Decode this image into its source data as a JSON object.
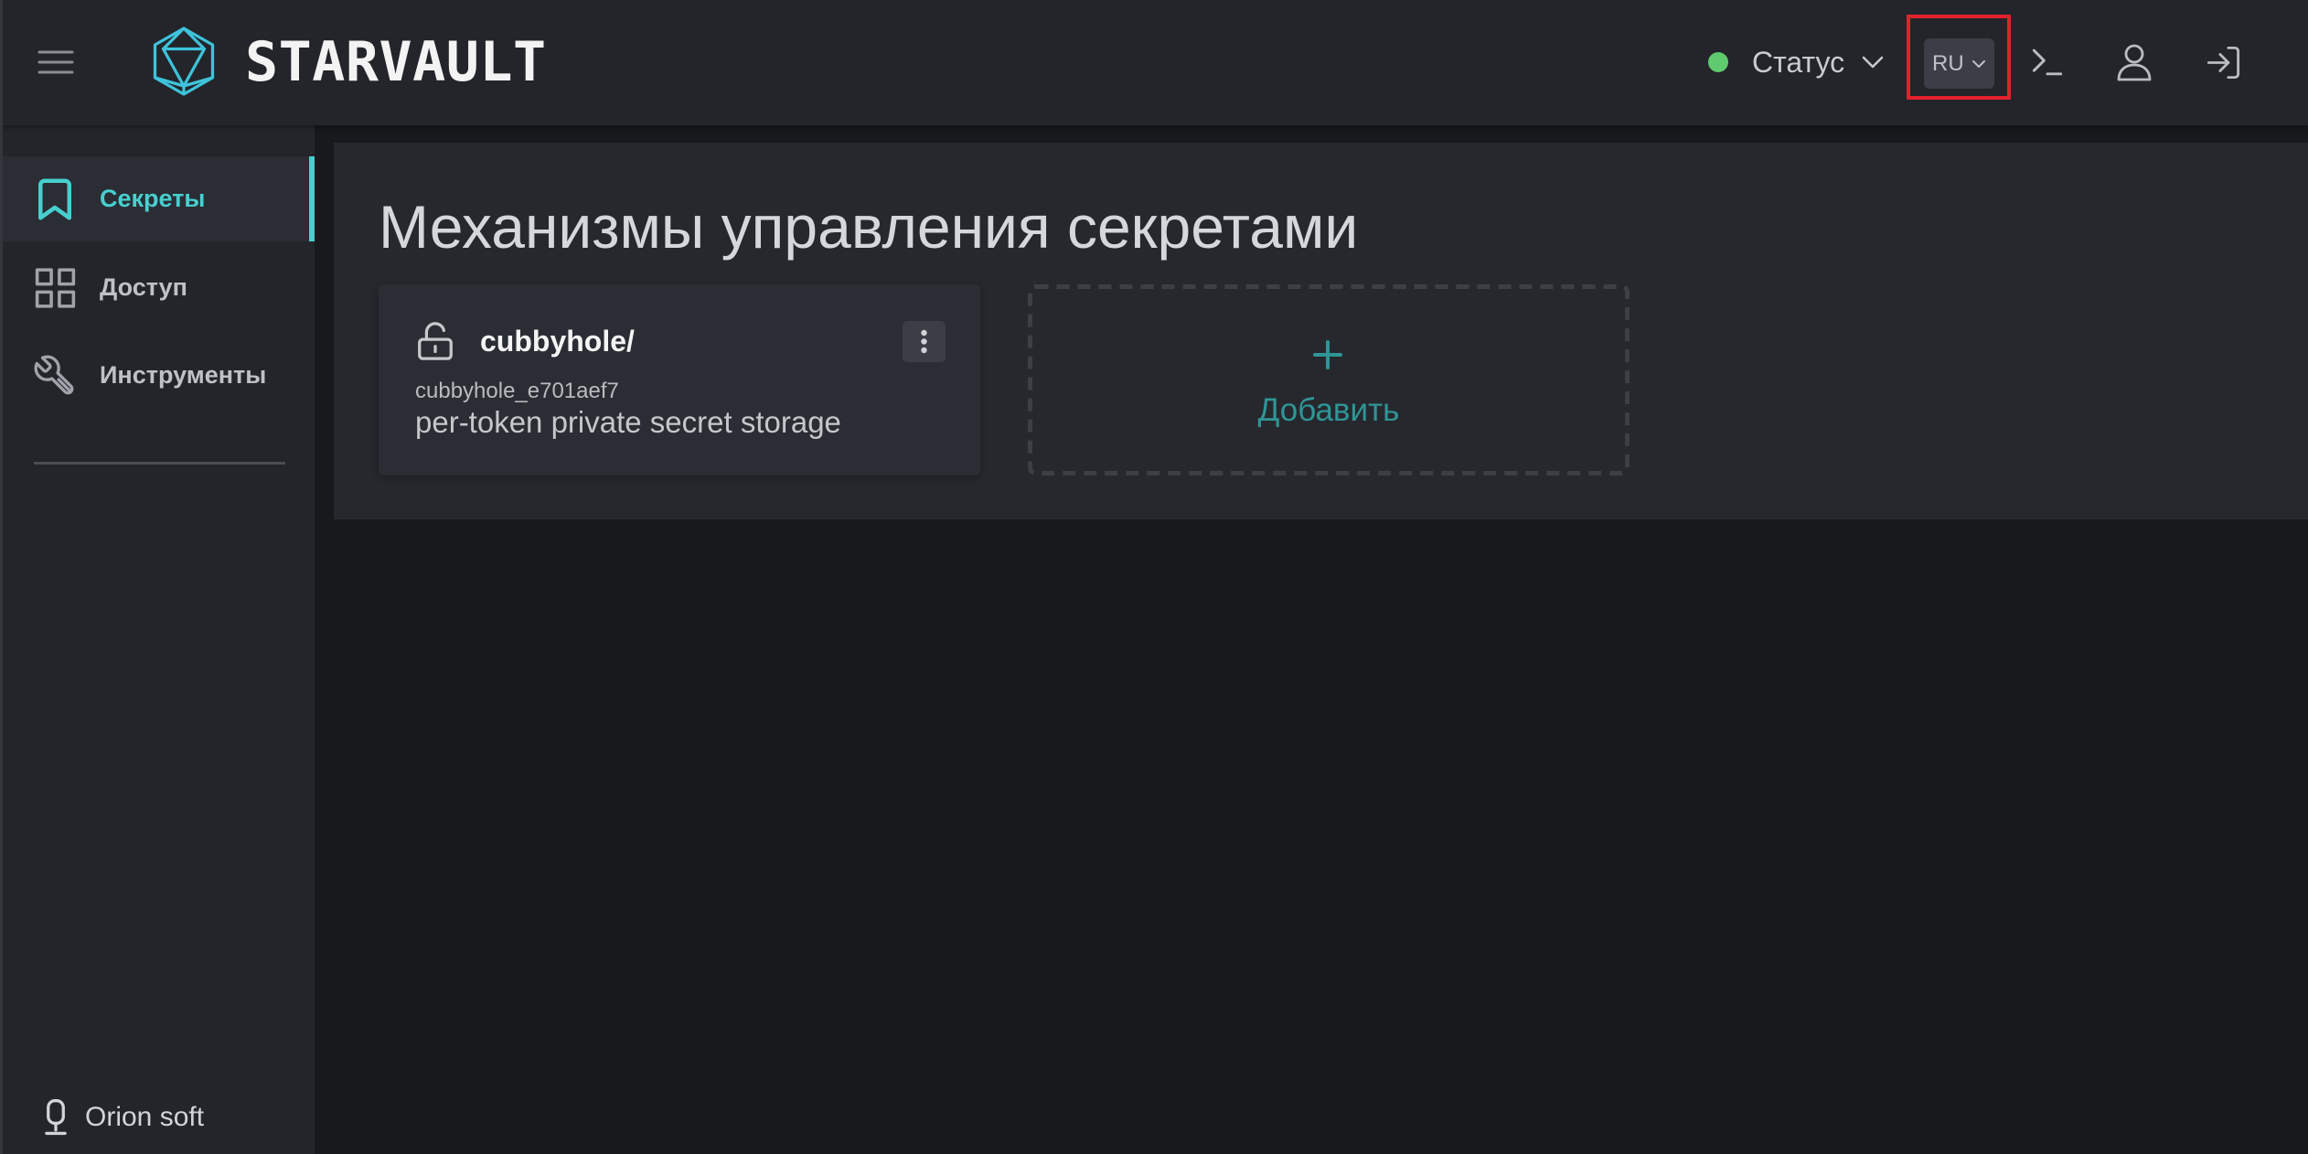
{
  "header": {
    "menu_icon": "hamburger-icon",
    "logo_icon": "starvault-logo-icon",
    "brand": "STARVAULT",
    "status": {
      "label": "Статус",
      "indicator_color": "#5fca6e",
      "icon": "chevron-down-icon"
    },
    "language": {
      "selected": "RU",
      "icon": "chevron-down-icon",
      "highlighted": true
    },
    "actions": [
      {
        "icon": "terminal-icon"
      },
      {
        "icon": "user-icon"
      },
      {
        "icon": "logout-icon"
      }
    ]
  },
  "sidebar": {
    "items": [
      {
        "label": "Секреты",
        "icon": "bookmark-icon",
        "active": true
      },
      {
        "label": "Доступ",
        "icon": "grid-icon",
        "active": false
      },
      {
        "label": "Инструменты",
        "icon": "tools-icon",
        "active": false
      }
    ],
    "footer": {
      "label": "Orion soft",
      "icon": "orion-soft-icon"
    }
  },
  "main": {
    "title": "Механизмы управления секретами",
    "engines": [
      {
        "path": "cubbyhole/",
        "accessor": "cubbyhole_e701aef7",
        "description": "per-token private secret storage",
        "icon": "lock-open-icon",
        "menu_icon": "kebab-menu-icon"
      }
    ],
    "add_card": {
      "label": "Добавить",
      "icon": "plus-icon"
    }
  },
  "theme": {
    "accent": "#47cfcf",
    "add_accent": "#2f9595",
    "highlight": "#e3212b"
  }
}
